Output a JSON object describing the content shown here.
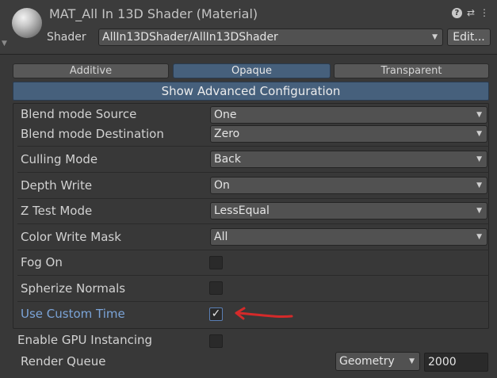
{
  "header": {
    "title": "MAT_All In 13D Shader (Material)",
    "shader_label": "Shader",
    "shader_value": "AllIn13DShader/AllIn13DShader",
    "edit_label": "Edit...",
    "icons": [
      "help-icon",
      "settings-sliders-icon",
      "more-icon"
    ]
  },
  "modes": [
    {
      "label": "Additive",
      "active": false
    },
    {
      "label": "Opaque",
      "active": true
    },
    {
      "label": "Transparent",
      "active": false
    }
  ],
  "advanced_label": "Show Advanced Configuration",
  "properties": {
    "blend_src": {
      "label": "Blend mode Source",
      "value": "One"
    },
    "blend_dst": {
      "label": "Blend mode Destination",
      "value": "Zero"
    },
    "culling": {
      "label": "Culling Mode",
      "value": "Back"
    },
    "depth_write": {
      "label": "Depth Write",
      "value": "On"
    },
    "ztest": {
      "label": "Z Test Mode",
      "value": "LessEqual"
    },
    "color_mask": {
      "label": "Color Write Mask",
      "value": "All"
    },
    "fog_on": {
      "label": "Fog On",
      "checked": false
    },
    "spherize": {
      "label": "Spherize Normals",
      "checked": false
    },
    "custom_time": {
      "label": "Use Custom Time",
      "checked": true
    }
  },
  "gpu_instancing": {
    "label": "Enable GPU Instancing",
    "checked": false
  },
  "render_queue": {
    "label": "Render Queue",
    "option": "Geometry",
    "value": "2000"
  },
  "annotation_color": "#d42a2a",
  "accent_color": "#46607c"
}
